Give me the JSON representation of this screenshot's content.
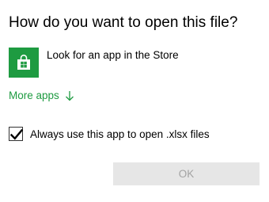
{
  "dialog": {
    "title": "How do you want to open this file?"
  },
  "store_option": {
    "label": "Look for an app in the Store",
    "icon": "store-bag-icon",
    "tile_color": "#1e9b41"
  },
  "more_apps": {
    "label": "More apps",
    "icon": "arrow-down-icon",
    "color": "#1e9b41"
  },
  "always_use": {
    "label": "Always use this app to open .xlsx files",
    "checked": true
  },
  "ok_button": {
    "label": "OK",
    "enabled": false
  }
}
